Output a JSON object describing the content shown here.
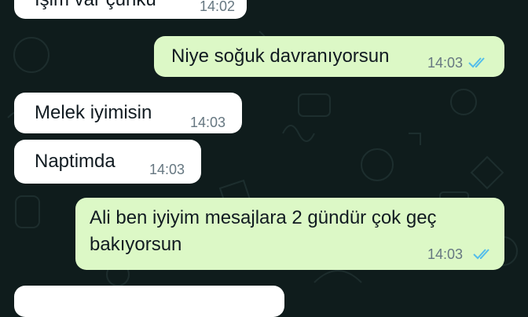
{
  "messages": [
    {
      "direction": "in",
      "text": "Işim var çünkü",
      "time": "14:02"
    },
    {
      "direction": "out",
      "text": "Niye soğuk davranıyorsun",
      "time": "14:03",
      "status": "read"
    },
    {
      "direction": "in",
      "text": "Melek iyimisin",
      "time": "14:03"
    },
    {
      "direction": "in",
      "text": "Naptimda",
      "time": "14:03"
    },
    {
      "direction": "out",
      "lines": [
        "Ali ben iyiyim mesajlara 2 gündür çok geç",
        "bakıyorsun"
      ],
      "time": "14:03",
      "status": "read"
    },
    {
      "direction": "in",
      "text": "",
      "time": ""
    }
  ],
  "colors": {
    "wallpaper": "#0f1c1c",
    "incoming_bubble": "#ffffff",
    "outgoing_bubble": "#dcf8c6",
    "read_ticks": "#53bdeb",
    "timestamp": "#667781"
  },
  "icons": [
    "double-check-read-icon"
  ]
}
